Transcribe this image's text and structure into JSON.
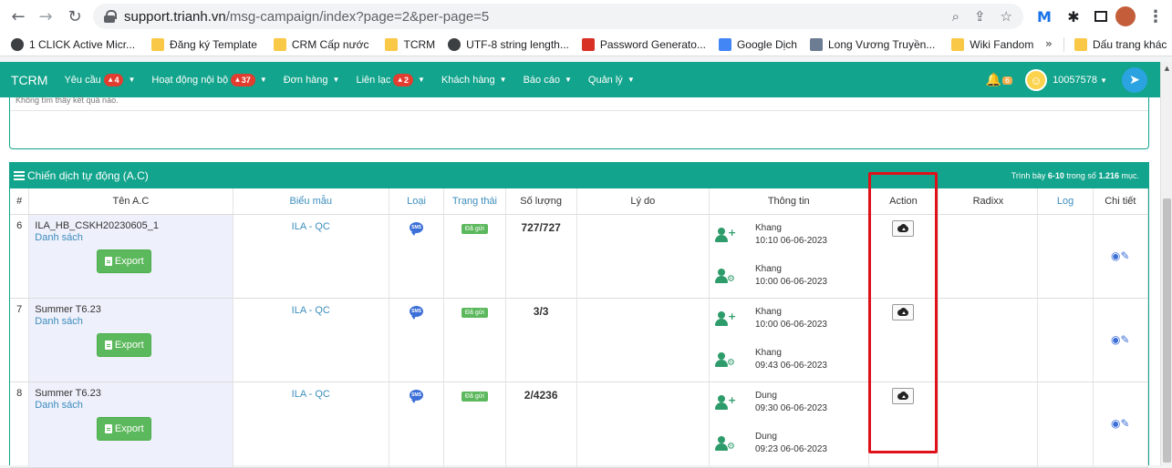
{
  "browser": {
    "url_host": "support.trianh.vn",
    "url_path": "/msg-campaign/index?page=2&per-page=5",
    "bookmarks": [
      {
        "label": "1 CLICK Active Micr...",
        "icon": "globe-icon"
      },
      {
        "label": "Đăng ký Template",
        "icon": "folder-icon"
      },
      {
        "label": "CRM Cấp nước",
        "icon": "folder-icon"
      },
      {
        "label": "TCRM",
        "icon": "folder-icon"
      },
      {
        "label": "UTF-8 string length...",
        "icon": "globe-icon"
      },
      {
        "label": "Password Generato...",
        "icon": "red-icon"
      },
      {
        "label": "Google Dịch",
        "icon": "translate-icon"
      },
      {
        "label": "Long Vương Truyền...",
        "icon": "image-icon"
      },
      {
        "label": "Wiki Fandom",
        "icon": "folder-icon"
      }
    ],
    "bookmarks_more": "»",
    "bookmarks_other": "Dấu trang khác"
  },
  "nav": {
    "brand": "TCRM",
    "menus": [
      {
        "label": "Yêu cầu",
        "badge": "4"
      },
      {
        "label": "Hoạt động nội bộ",
        "badge": "37"
      },
      {
        "label": "Đơn hàng",
        "badge": ""
      },
      {
        "label": "Liên lạc",
        "badge": "2"
      },
      {
        "label": "Khách hàng",
        "badge": ""
      },
      {
        "label": "Báo cáo",
        "badge": ""
      },
      {
        "label": "Quản lý",
        "badge": ""
      }
    ],
    "bell_count": "6",
    "user_id": "10057578"
  },
  "prev_panel": {
    "empty_text": "Không tìm thấy kết quả nào."
  },
  "panel": {
    "title": "Chiến dịch tự động (A.C)",
    "summary_prefix": "Trình bày ",
    "summary_range": "6-10",
    "summary_mid": " trong số ",
    "summary_total": "1.216",
    "summary_suffix": " mục.",
    "columns": [
      "#",
      "Tên A.C",
      "Biểu mẫu",
      "Loại",
      "Trạng thái",
      "Số lượng",
      "Lý do",
      "Thông tin",
      "Action",
      "Radixx",
      "Log",
      "Chi tiết"
    ],
    "export_label": "Export",
    "list_label": "Danh sách",
    "sms_label": "SMS",
    "rows": [
      {
        "num": "6",
        "name": "ILA_HB_CSKH20230605_1",
        "form": "ILA - QC",
        "status": "Đã gửi",
        "qty": "727/727",
        "reason": "",
        "created_by": "Khang",
        "created_at": "10:10 06-06-2023",
        "updated_by": "Khang",
        "updated_at": "10:00 06-06-2023"
      },
      {
        "num": "7",
        "name": "Summer T6.23",
        "form": "ILA - QC",
        "status": "Đã gửi",
        "qty": "3/3",
        "reason": "",
        "created_by": "Khang",
        "created_at": "10:00 06-06-2023",
        "updated_by": "Khang",
        "updated_at": "09:43 06-06-2023"
      },
      {
        "num": "8",
        "name": "Summer T6.23",
        "form": "ILA - QC",
        "status": "Đã gửi",
        "qty": "2/4236",
        "reason": "",
        "created_by": "Dung",
        "created_at": "09:30 06-06-2023",
        "updated_by": "Dung",
        "updated_at": "09:23 06-06-2023"
      }
    ]
  },
  "colors": {
    "accent": "#12a48c",
    "highlight": "#e0101a",
    "export": "#5cb85c",
    "link": "#3c8dbc"
  }
}
